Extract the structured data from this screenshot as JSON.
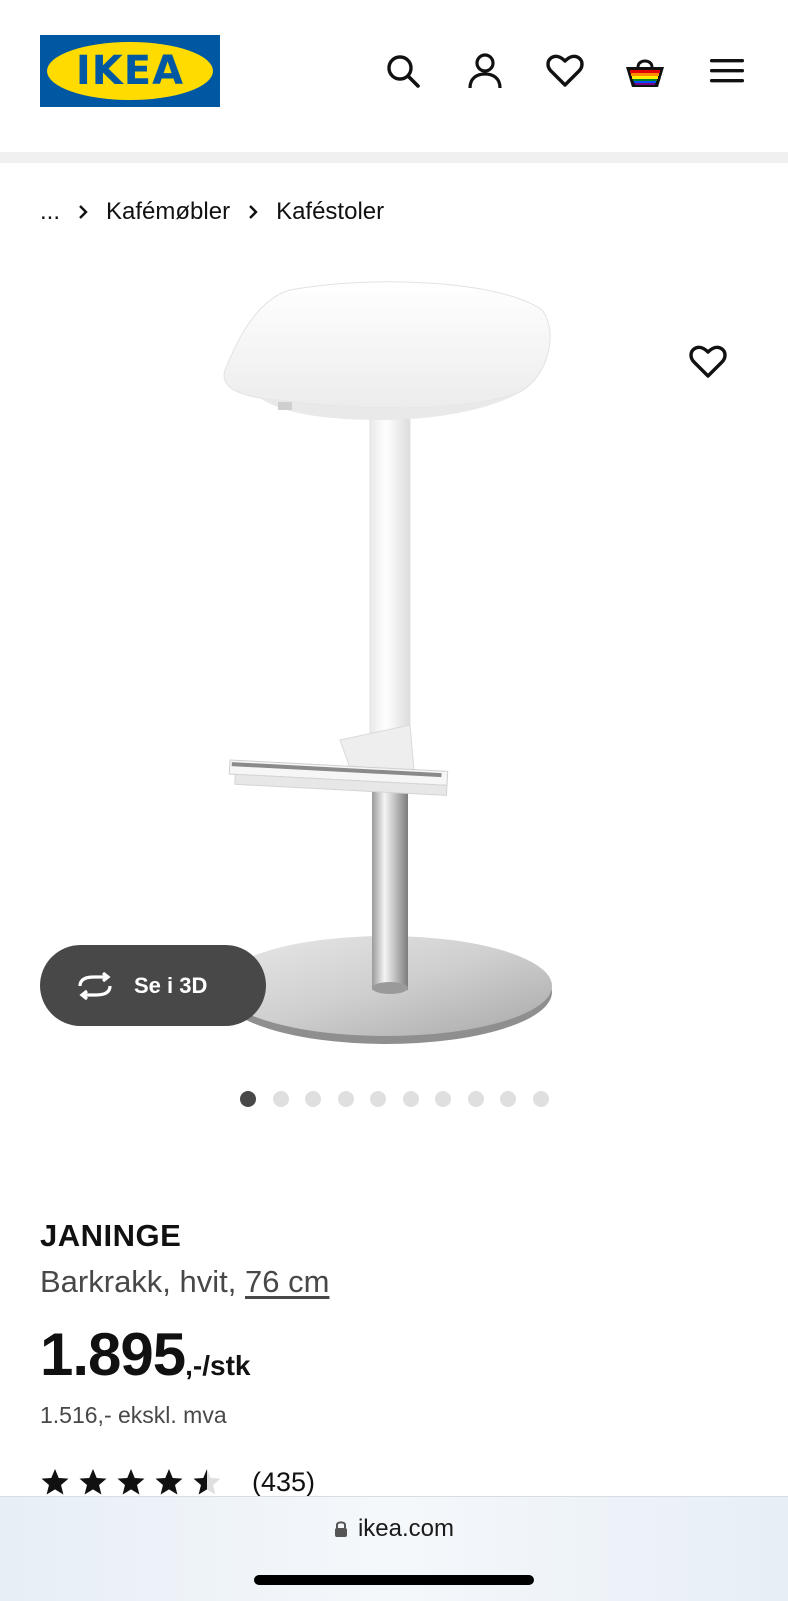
{
  "header": {
    "logo_text": "IKEA",
    "brand_colors": {
      "blue": "#0058a3",
      "yellow": "#ffdb00"
    },
    "icons": [
      "search-icon",
      "user-icon",
      "heart-icon",
      "basket-icon",
      "menu-icon"
    ]
  },
  "breadcrumb": {
    "items": [
      "...",
      "Kafémøbler",
      "Kaféstoler"
    ]
  },
  "gallery": {
    "see_3d_label": "Se i 3D",
    "dot_count": 10,
    "active_dot": 0
  },
  "product": {
    "name": "JANINGE",
    "description": "Barkrakk, hvit, ",
    "size": "76 cm",
    "price_main": "1.895",
    "price_suffix": ",-/stk",
    "price_ex_vat": "1.516,- ekskl. mva",
    "rating": 4.5,
    "review_count": "(435)"
  },
  "browser": {
    "url": "ikea.com"
  }
}
